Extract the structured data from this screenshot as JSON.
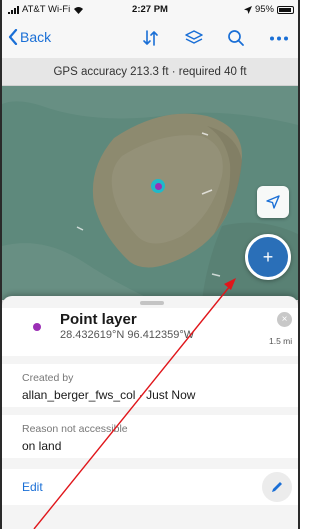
{
  "status_bar": {
    "carrier": "AT&T Wi-Fi",
    "time": "2:27 PM",
    "battery": "95%"
  },
  "nav": {
    "back_label": "Back",
    "icons": [
      "sort-icon",
      "layers-icon",
      "search-icon",
      "more-icon"
    ]
  },
  "gps_banner": {
    "text": "GPS accuracy 213.3 ft · required 40 ft"
  },
  "map": {
    "add_icon": "+",
    "colors": {
      "water": "#5f8a7e",
      "land": "#8f8a70",
      "pin_ring": "#20b9c9",
      "pin_core": "#9b2fb5",
      "add_button": "#2a6fb8"
    }
  },
  "feature": {
    "title": "Point layer",
    "coords": "28.432619°N  96.412359°W",
    "distance": "1.5 mi",
    "close_icon": "×"
  },
  "fields": [
    {
      "label": "Created by",
      "value": "allan_berger_fws_col · Just Now"
    },
    {
      "label": "Reason not accessible",
      "value": "on land"
    }
  ],
  "edit": {
    "label": "Edit"
  },
  "colors": {
    "accent": "#1a6fd6",
    "annotation": "#e0161b"
  }
}
